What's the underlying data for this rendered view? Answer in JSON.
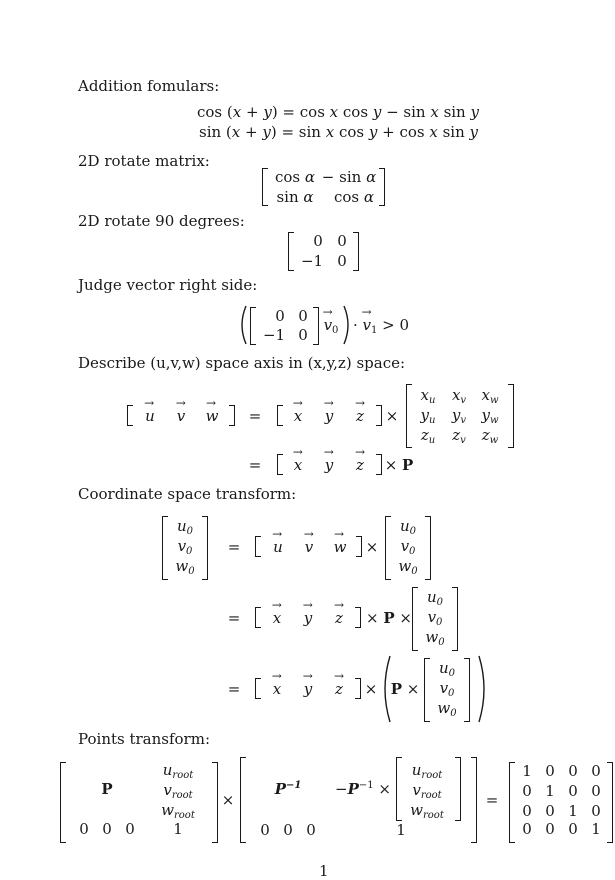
{
  "headings": {
    "addition": "Addition fomulars:",
    "rotate2d": "2D rotate matrix:",
    "rotate90": "2D rotate 90 degrees:",
    "judge": "Judge vector right side:",
    "describe": "Describe (u,v,w) space axis in (x,y,z) space:",
    "coord": "Coordinate space transform:",
    "points": "Points transform:"
  },
  "equations": {
    "addition": [
      "cos (x + y) = cos x cos y − sin x sin y",
      "sin (x + y) = sin x cos y + cos x sin y"
    ],
    "rotate2d_matrix": [
      [
        "cos α",
        "− sin α"
      ],
      [
        "sin α",
        "cos α"
      ]
    ],
    "rotate90_matrix": [
      [
        "0",
        "0"
      ],
      [
        "−1",
        "0"
      ]
    ],
    "judge": "([0 0; −1 0] v0) · v1 > 0",
    "describe_lhs": [
      "u",
      "v",
      "w"
    ],
    "describe_axes": [
      "x",
      "y",
      "z"
    ],
    "describe_matrix": [
      [
        "x_u",
        "x_v",
        "x_w"
      ],
      [
        "y_u",
        "y_v",
        "y_w"
      ],
      [
        "z_u",
        "z_v",
        "z_w"
      ]
    ],
    "describe_P": "P",
    "coord_vector": [
      "u0",
      "v0",
      "w0"
    ],
    "points_P": "P",
    "points_Pinv": "P⁻¹",
    "points_neg_Pinv": "−P⁻¹ ×",
    "points_root": [
      "u_root",
      "v_root",
      "w_root"
    ],
    "points_bottom_left": [
      "0",
      "0",
      "0",
      "1"
    ],
    "identity": [
      [
        "1",
        "0",
        "0",
        "0"
      ],
      [
        "0",
        "1",
        "0",
        "0"
      ],
      [
        "0",
        "0",
        "1",
        "0"
      ],
      [
        "0",
        "0",
        "0",
        "1"
      ]
    ]
  },
  "page_number": "1"
}
